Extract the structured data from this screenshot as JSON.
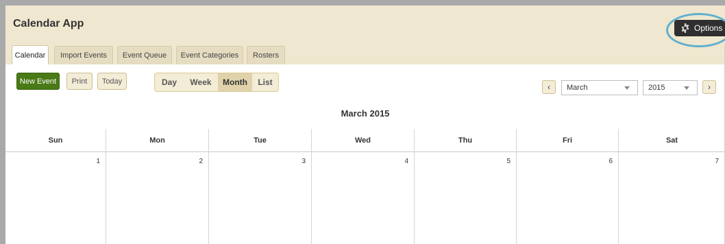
{
  "app": {
    "title": "Calendar App"
  },
  "options": {
    "label": "Options",
    "icon": "gear-icon"
  },
  "tabs": [
    {
      "label": "Calendar",
      "active": true
    },
    {
      "label": "Import Events"
    },
    {
      "label": "Event Queue"
    },
    {
      "label": "Event Categories"
    },
    {
      "label": "Rosters"
    }
  ],
  "toolbar": {
    "new_event": "New Event",
    "print": "Print",
    "today": "Today",
    "views": [
      "Day",
      "Week",
      "Month",
      "List"
    ],
    "active_view": "Month"
  },
  "navigation": {
    "prev_icon": "chevron-left-icon",
    "next_icon": "chevron-right-icon",
    "month_select": "March",
    "year_select": "2015"
  },
  "calendar": {
    "title": "March 2015",
    "days": [
      "Sun",
      "Mon",
      "Tue",
      "Wed",
      "Thu",
      "Fri",
      "Sat"
    ],
    "dates": [
      "1",
      "2",
      "3",
      "4",
      "5",
      "6",
      "7"
    ]
  },
  "colors": {
    "header_bg": "#efe7cf",
    "tab_bg": "#e6dcc1",
    "new_event_bg": "#4a7a16",
    "options_bg": "#2f2f2f",
    "highlight_ring": "#5fb0cf"
  }
}
